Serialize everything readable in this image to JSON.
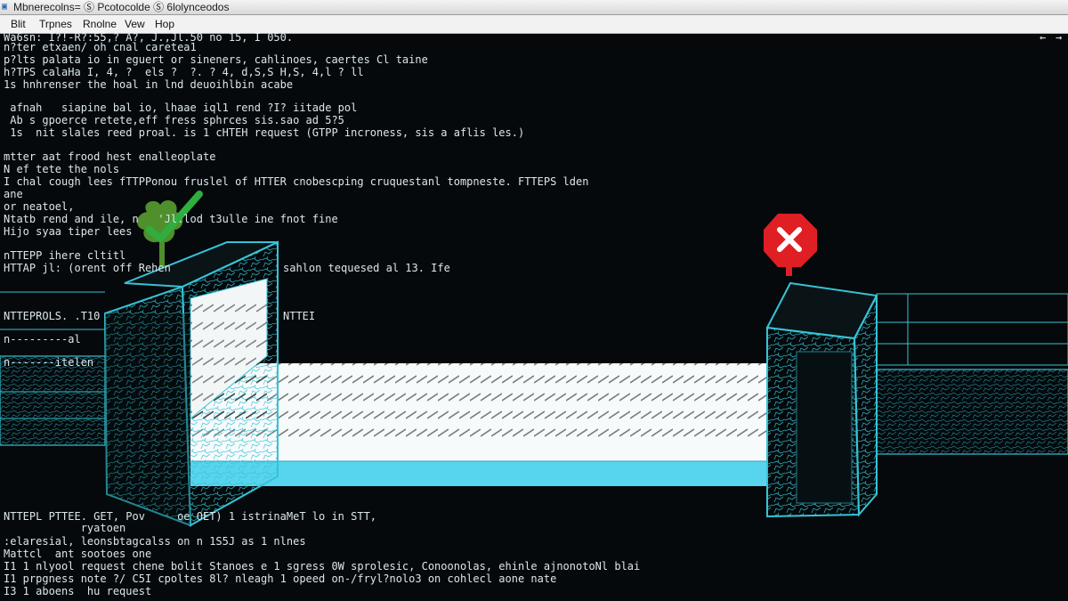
{
  "window": {
    "title": "Mbnerecolns= Ⓢ Pcotocolde Ⓢ 6lolynceodos",
    "icon": "terminal-icon"
  },
  "menu": {
    "items": [
      "Blit",
      "Trpnes",
      "Rnolne",
      "Vew",
      "Hop"
    ]
  },
  "terminal": {
    "lines": [
      "Wa6sn: I?!-R?:55,? A?, J.,Jl.50 no 15, I 050.",
      "n?ter etxaen/ oh cnal caretea1",
      "p?lts palata io in eguert or sineners, cahlinoes, caertes Cl taine",
      "h?TPS calaHa I, 4, ?  els ?  ?. ? 4, d,S,S H,S, 4,l ? ll",
      "1s hnhrenser the hoal in lnd deuoihlbin acabe",
      " afnah   siapine bal io, lhaae iql1 rend ?I? iitade pol",
      " Ab s gpoerce retete,eff fress sphrces sis.sao ad 5?5",
      " 1s  nit slales reed proal. is 1 cHTEH request (GTPP incroness, sis a aflis les.)",
      "mtter aat frood hest enalleoplate",
      "N ef tete the nols",
      "I chal cough lees fTTPPonou fruslel of HTTER cnobescping cruquestanl tompneste. FTTEPS lden",
      "ane",
      "or neatoel,",
      "Ntatb rend and ile, n   'Jl.lod t3ulle ine fnot fine",
      "Hijo syaa tiper lees",
      "nTTEPP ihere cltitl",
      "HTTAP jl: (orent off Rehen",
      "sahlon tequesed al 13. Ife",
      "NTTEPROLS. .T10",
      "NTTEI",
      "n---------al",
      "n-------itelen",
      "NTTEPL PTTEE. GET, Pov     oe OET) 1 istrinaMeT lo in STT,",
      "            ryatoen",
      ":elaresial, leonsbtagcalss on n 1S5J as 1 nlnes",
      "Mattcl  ant sootoes one",
      "I1 1 nlyool request chene bolit Stanoes e 1 sgress 0W sprolesic, Conoonolas, ehinle ajnonotoNl blai",
      "I1 prpgness note ?/ C5I cpoltes 8l? nleagh 1 opeed on-/fryl?nolo3 on cohlecl aone nate",
      "I3 1 aboens  hu request"
    ],
    "scroll_indicators": [
      "←",
      "→"
    ]
  },
  "scene": {
    "left_gate_status": "check-icon",
    "right_gate_status": "error-x-icon",
    "colors": {
      "wireframe": "#36c3d6",
      "wireframe_dim": "#1f7f8c",
      "bridge_deck": "#f7fafb",
      "bridge_edge": "#58d5ee",
      "check_green": "#2fae3f",
      "blob_green": "#4f8f2c",
      "error_red": "#e01f24"
    }
  }
}
